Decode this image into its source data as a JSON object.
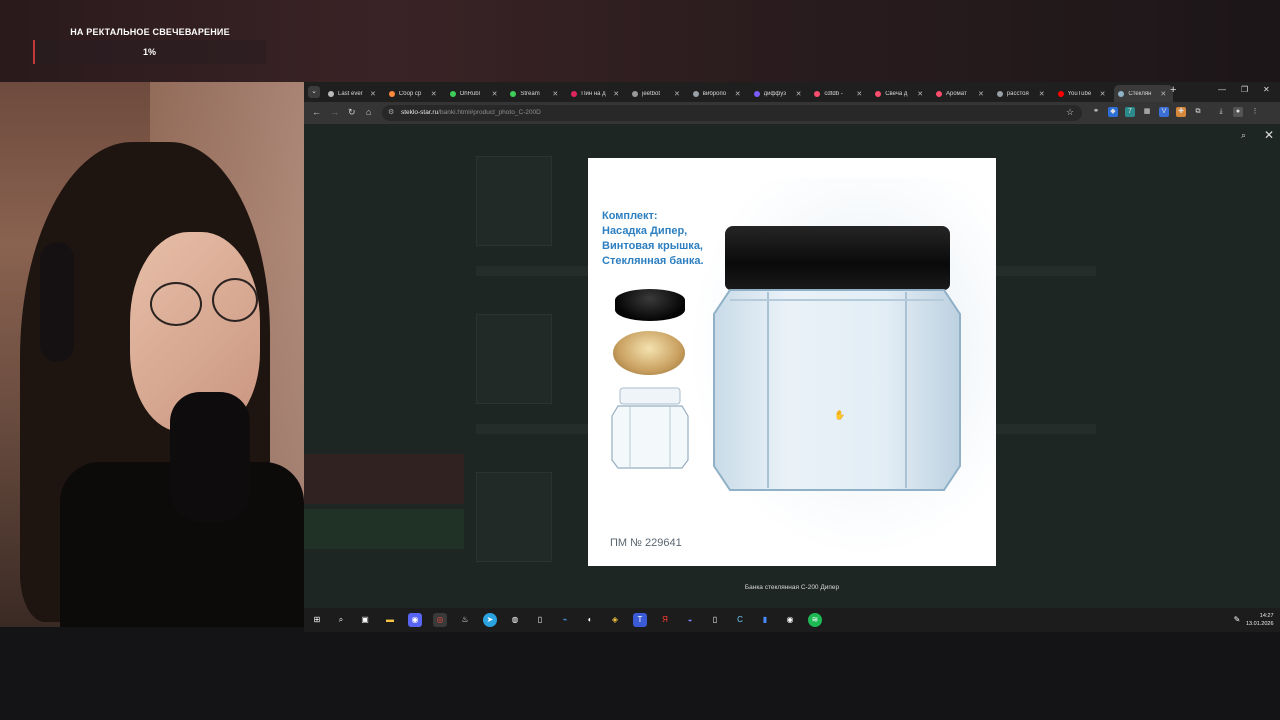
{
  "stream_overlay": {
    "goal_title": "НА РЕКТАЛЬНОЕ СВЕЧЕВАРЕНИЕ",
    "goal_percent_label": "1%",
    "goal_progress": 0.01
  },
  "browser": {
    "tabs": [
      {
        "label": "Last ever",
        "favicon_color": "#bbbbbb"
      },
      {
        "label": "Сбор ср",
        "favicon_color": "#ff8a3d"
      },
      {
        "label": "OhRubl",
        "favicon_color": "#3ecf5a"
      },
      {
        "label": "Stream",
        "favicon_color": "#3ecf5a"
      },
      {
        "label": "Пин на д",
        "favicon_color": "#e0245e"
      },
      {
        "label": "jeetbot",
        "favicon_color": "#999999"
      },
      {
        "label": "вибропо",
        "favicon_color": "#9aa0a6"
      },
      {
        "label": "диффуз",
        "favicon_color": "#7c5cff"
      },
      {
        "label": "cdtdb - ",
        "favicon_color": "#ff4d6d"
      },
      {
        "label": "Свеча д",
        "favicon_color": "#ff4d6d"
      },
      {
        "label": "Аромат",
        "favicon_color": "#ff4d6d"
      },
      {
        "label": "расстоя",
        "favicon_color": "#9aa0a6"
      },
      {
        "label": "YouTube",
        "favicon_color": "#ff0000"
      },
      {
        "label": "Стеклян",
        "favicon_color": "#8fb3c8"
      }
    ],
    "active_tab_index": 13,
    "new_tab_symbol": "+",
    "url_host": "steklo-star.ru",
    "url_path": "/banki.html#product_photo_C-200D"
  },
  "lightbox": {
    "photo_heading_lines": [
      "Комплект:",
      "Насадка Дипер,",
      "Винтовая крышка,",
      "Стеклянная банка."
    ],
    "photo_code": "ПМ № 229641",
    "caption": "Банка стеклянная С-200 Дипер"
  },
  "taskbar": {
    "time": "14:27",
    "date": "13.01.2026"
  }
}
